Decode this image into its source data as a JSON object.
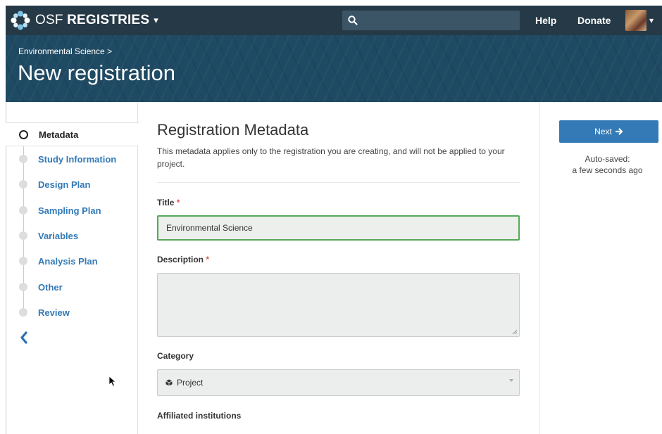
{
  "navbar": {
    "brand_light": "OSF ",
    "brand_bold": "REGISTRIES",
    "help": "Help",
    "donate": "Donate"
  },
  "banner": {
    "breadcrumb": "Environmental Science >",
    "title": "New registration"
  },
  "sidebar": {
    "steps": [
      {
        "label": "Metadata",
        "active": true
      },
      {
        "label": "Study Information"
      },
      {
        "label": "Design Plan"
      },
      {
        "label": "Sampling Plan"
      },
      {
        "label": "Variables"
      },
      {
        "label": "Analysis Plan"
      },
      {
        "label": "Other"
      },
      {
        "label": "Review"
      }
    ]
  },
  "form": {
    "title": "Registration Metadata",
    "description": "This metadata applies only to the registration you are creating, and will not be applied to your project.",
    "title_label": "Title",
    "title_value": "Environmental Science",
    "description_label": "Description",
    "description_value": "",
    "category_label": "Category",
    "category_value": "Project",
    "affiliated_label": "Affiliated institutions",
    "required_mark": "*"
  },
  "actions": {
    "next_label": "Next",
    "autosave_line1": "Auto-saved:",
    "autosave_line2": "a few seconds ago"
  },
  "colors": {
    "navbar": "#263947",
    "banner": "#1f4a63",
    "link": "#337ab7",
    "focus": "#57a958",
    "required": "#d9534f"
  }
}
